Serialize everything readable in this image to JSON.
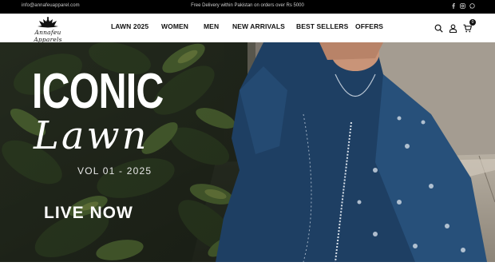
{
  "topbar": {
    "email": "info@annafeuapparel.com",
    "promo": "Free Delivery within Pakistan on orders over Rs 5000",
    "social": [
      {
        "icon": "facebook-icon"
      },
      {
        "icon": "instagram-icon"
      },
      {
        "icon": "whatsapp-icon"
      }
    ]
  },
  "header": {
    "logo_text": "Annafeu Apparels",
    "nav": [
      {
        "label": "LAWN 2025"
      },
      {
        "label": "WOMEN"
      },
      {
        "label": "MEN"
      },
      {
        "label": "NEW ARRIVALS"
      },
      {
        "label": "BEST SELLERS"
      },
      {
        "label": "OFFERS"
      }
    ],
    "cart_count": "0",
    "icons": [
      "search-icon",
      "user-icon",
      "cart-icon"
    ]
  },
  "hero": {
    "headline": "ICONIC",
    "script": "Lawn",
    "volume": "VOL 01 - 2025",
    "cta": "LIVE NOW"
  },
  "colors": {
    "topbar_bg": "#000000",
    "dress_blue": "#1e3f63",
    "text": "#111111"
  }
}
